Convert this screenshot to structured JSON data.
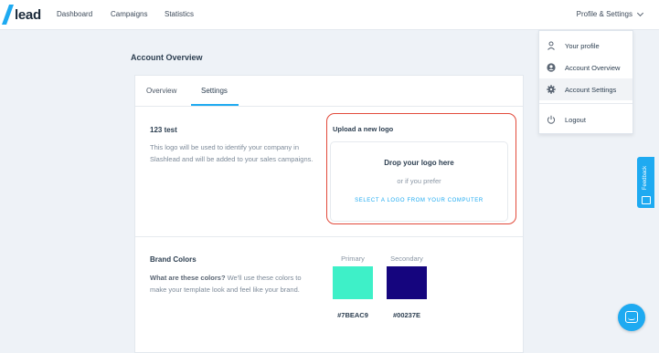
{
  "brand": {
    "logo_text": "lead",
    "accent": "#1eaaf1"
  },
  "nav": {
    "items": [
      {
        "label": "Dashboard"
      },
      {
        "label": "Campaigns"
      },
      {
        "label": "Statistics"
      }
    ],
    "profile_label": "Profile & Settings"
  },
  "dropdown": {
    "items": [
      {
        "label": "Your profile",
        "icon": "person-icon"
      },
      {
        "label": "Account Overview",
        "icon": "account-circle-icon"
      },
      {
        "label": "Account Settings",
        "icon": "gear-icon",
        "active": true
      },
      {
        "label": "Logout",
        "icon": "power-icon"
      }
    ]
  },
  "page": {
    "title": "Account Overview"
  },
  "tabs": [
    {
      "label": "Overview"
    },
    {
      "label": "Settings",
      "active": true
    }
  ],
  "logo_section": {
    "company_name": "123 test",
    "description": "This logo will be used to identify your company in Slashlead and will be added to your sales campaigns.",
    "upload_title": "Upload a new logo",
    "drop_text": "Drop your logo here",
    "or_text": "or if you prefer",
    "select_link": "SELECT A LOGO FROM YOUR COMPUTER"
  },
  "brand_colors": {
    "title": "Brand Colors",
    "question": "What are these colors?",
    "description": " We'll use these colors to make your template look and feel like your brand.",
    "primary": {
      "label": "Primary",
      "hex": "#7BEAC9",
      "color": "#3ef0c8"
    },
    "secondary": {
      "label": "Secondary",
      "hex": "#00237E",
      "color": "#15057e"
    }
  },
  "feedback": {
    "label": "Feedback"
  }
}
